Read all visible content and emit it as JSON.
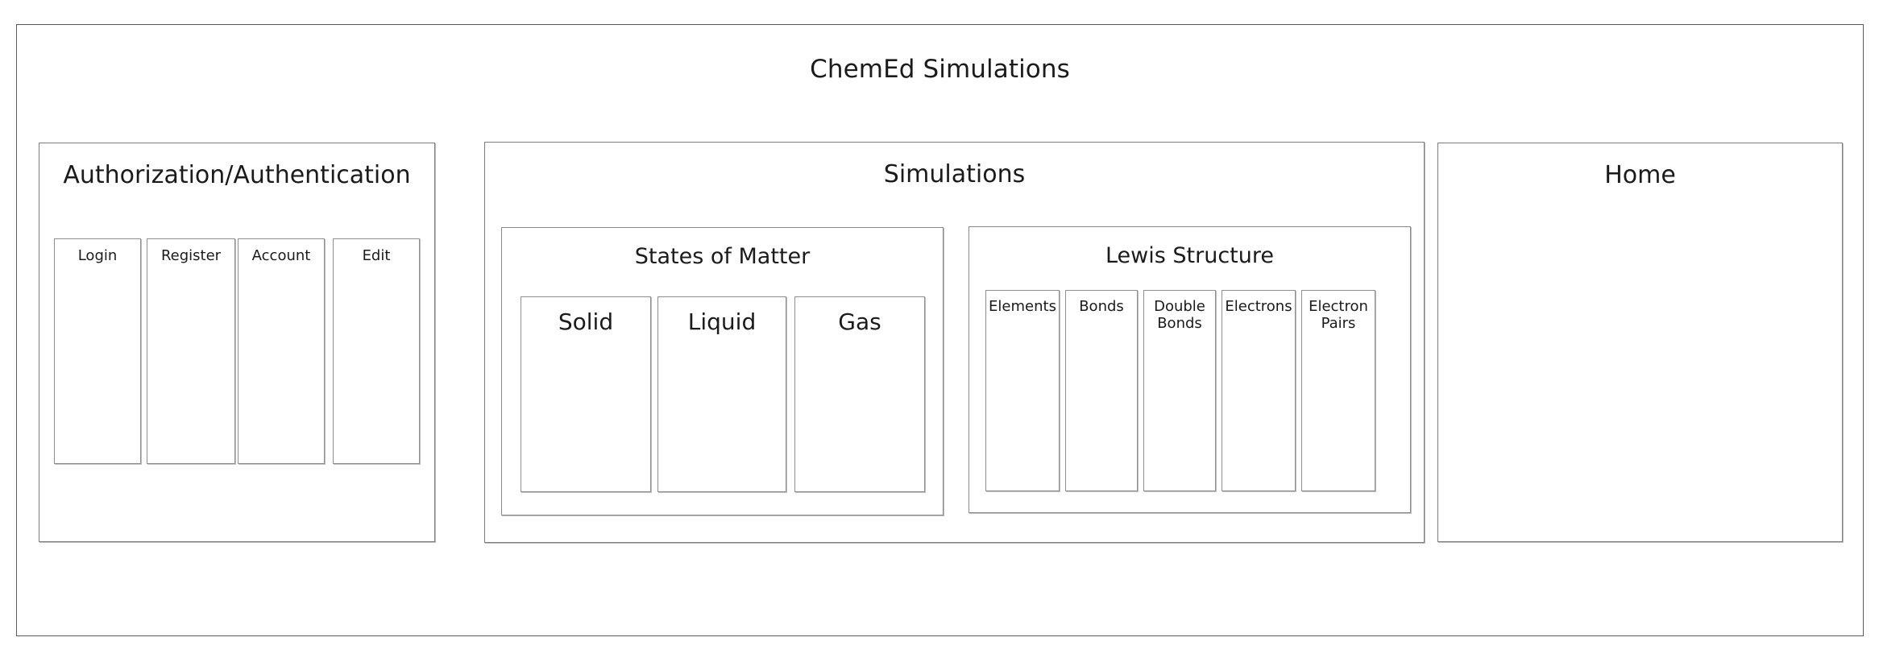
{
  "app": {
    "title": "ChemEd Simulations"
  },
  "panels": {
    "auth": {
      "title": "Authorization/Authentication",
      "items": [
        {
          "label": "Login"
        },
        {
          "label": "Register"
        },
        {
          "label": "Account"
        },
        {
          "label": "Edit"
        }
      ]
    },
    "simulations": {
      "title": "Simulations",
      "groups": [
        {
          "title": "States of Matter",
          "items": [
            {
              "label": "Solid"
            },
            {
              "label": "Liquid"
            },
            {
              "label": "Gas"
            }
          ]
        },
        {
          "title": "Lewis Structure",
          "items": [
            {
              "label": "Elements"
            },
            {
              "label": "Bonds"
            },
            {
              "label": "Double Bonds"
            },
            {
              "label": "Electrons"
            },
            {
              "label": "Electron Pairs"
            }
          ]
        }
      ]
    },
    "home": {
      "title": "Home"
    }
  },
  "colors": {
    "background": "#ffffff",
    "outer_border": "#5a5a5a",
    "box_border": "#7d7d7d",
    "box_shadow": "#bdbdbd",
    "text": "#1b1b1b"
  }
}
